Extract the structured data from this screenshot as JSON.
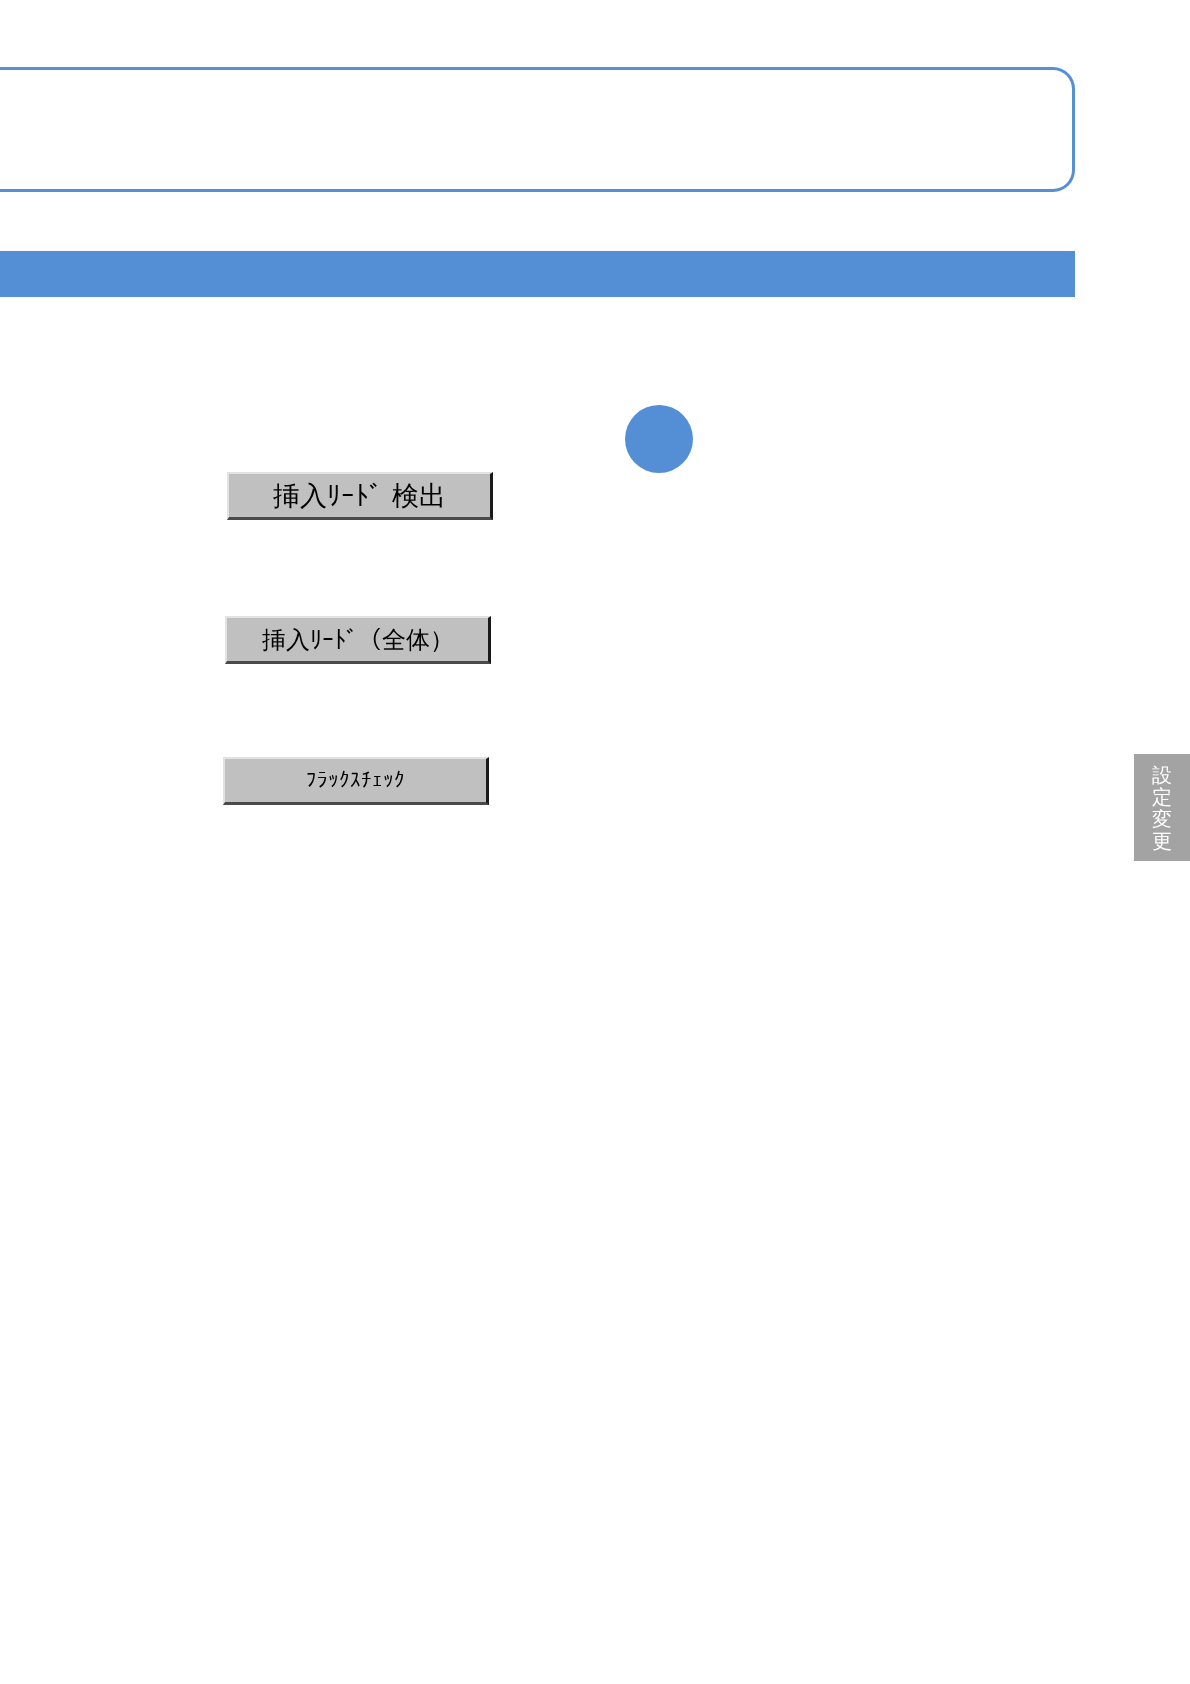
{
  "buttons": [
    {
      "label": "挿入ﾘｰﾄﾞ 検出"
    },
    {
      "label": "挿入ﾘｰﾄﾞ（全体）"
    },
    {
      "label": "ﾌﾗｯｸｽﾁｪｯｸ"
    }
  ],
  "side_tab": {
    "label": "設定変更"
  }
}
